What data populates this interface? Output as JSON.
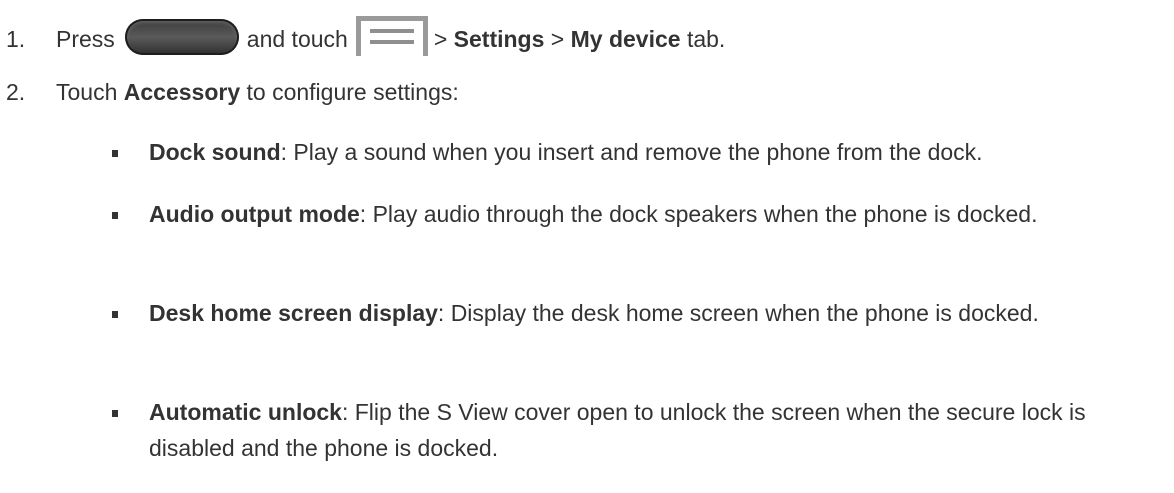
{
  "steps": [
    {
      "number": "1.",
      "text_press": "Press",
      "text_touch": "and touch",
      "text_sep1": ">",
      "settings": "Settings",
      "text_sep2": ">",
      "my_device": "My device",
      "text_tab": "tab."
    },
    {
      "number": "2.",
      "text_touch": "Touch",
      "accessory": "Accessory",
      "text_rest": "to configure settings:"
    }
  ],
  "icons": {
    "home_key": "home-key-icon",
    "menu_key": "menu-key-icon"
  },
  "bullets": [
    {
      "term": "Dock sound",
      "desc": ": Play a sound when you insert and remove the phone from the dock."
    },
    {
      "term": "Audio output mode",
      "desc": ": Play audio through the dock speakers when the phone is docked."
    },
    {
      "term": "Desk home screen display",
      "desc": ": Display the desk home screen when the phone is docked."
    },
    {
      "term": "Automatic unlock",
      "desc": ": Flip the S View cover open to unlock the screen when the secure lock is disabled and the phone is docked."
    }
  ]
}
